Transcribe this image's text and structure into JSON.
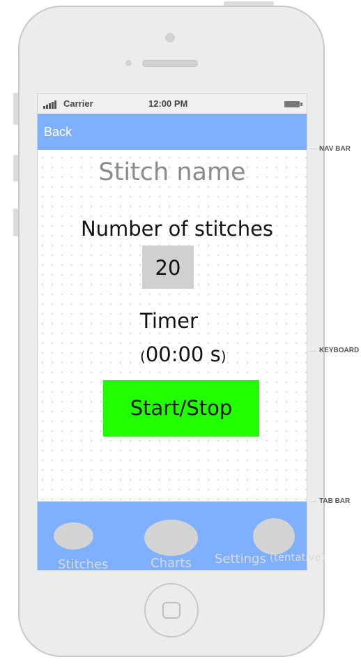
{
  "status_bar": {
    "carrier": "Carrier",
    "time": "12:00 PM"
  },
  "nav_bar": {
    "back_label": "Back"
  },
  "content": {
    "stitch_name": "Stitch name",
    "count_label": "Number of stitches",
    "count_value": "20",
    "timer_label": "Timer",
    "timer_open": "(",
    "timer_value": "00:00 s",
    "timer_close": ")",
    "start_stop_label": "Start/Stop"
  },
  "tab_bar": {
    "tabs": [
      {
        "label": "Stitches"
      },
      {
        "label": "Charts"
      },
      {
        "label": "Settings",
        "hint": "(tentative)"
      }
    ]
  },
  "annotations": {
    "nav_bar": "NAV BAR",
    "keyboard": "KEYBOARD",
    "tab_bar": "TAB BAR"
  },
  "colors": {
    "nav_bar": "#7fb0ff",
    "tab_bar": "#7fb0ff",
    "start_button": "#22ff00",
    "count_box": "#d0d0d0"
  }
}
